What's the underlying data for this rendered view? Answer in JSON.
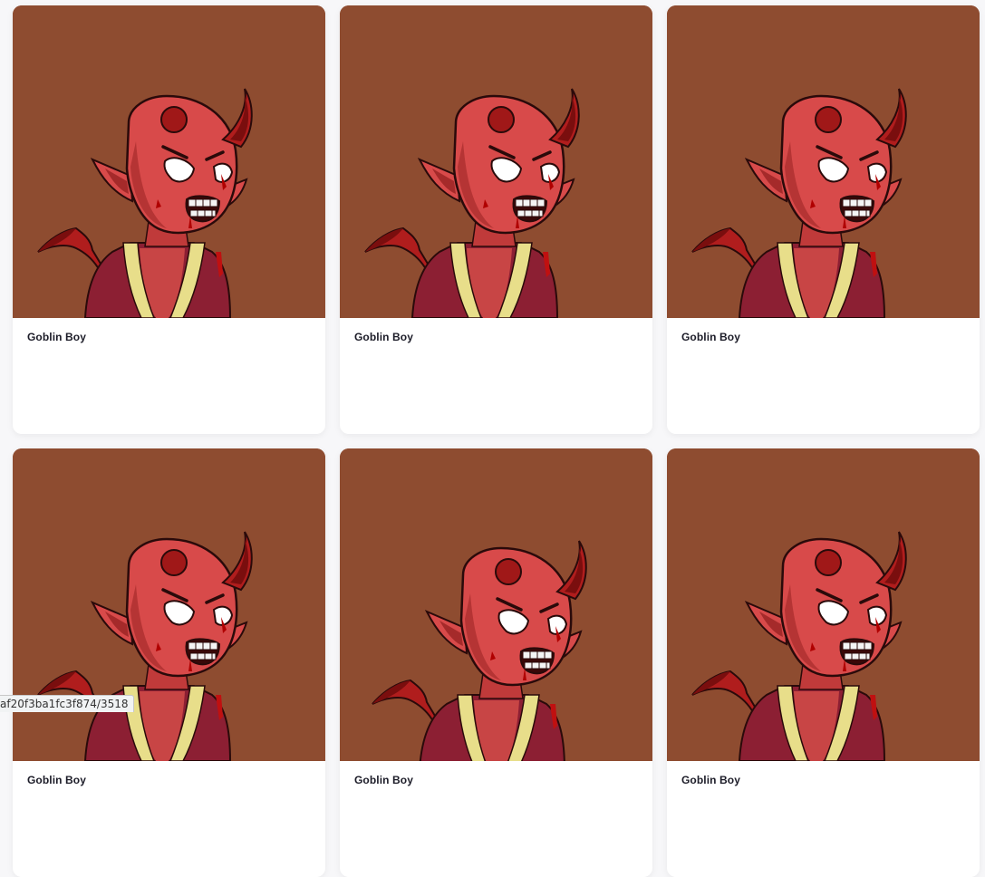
{
  "colors": {
    "image_background": "#8e4c30",
    "card_background": "#ffffff",
    "skin": "#d84a4a",
    "horn": "#b01d1d",
    "robe": "#8c1f33",
    "robe_trim": "#e8de8a"
  },
  "cards": [
    {
      "title": "Goblin Boy",
      "image": "goblin-boy-artwork"
    },
    {
      "title": "Goblin Boy",
      "image": "goblin-boy-artwork"
    },
    {
      "title": "Goblin Boy",
      "image": "goblin-boy-artwork"
    },
    {
      "title": "Goblin Boy",
      "image": "goblin-boy-artwork"
    },
    {
      "title": "Goblin Boy",
      "image": "goblin-boy-artwork"
    },
    {
      "title": "Goblin Boy",
      "image": "goblin-boy-artwork"
    }
  ],
  "status_bar": {
    "url_text": "af20f3ba1fc3f874/3518"
  }
}
